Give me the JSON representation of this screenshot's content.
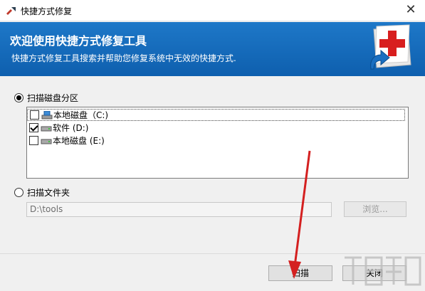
{
  "window": {
    "title": "快捷方式修复",
    "close_icon": "close-icon",
    "app_icon": "app-shortcut-icon"
  },
  "banner": {
    "title": "欢迎使用快捷方式修复工具",
    "description": "快捷方式修复工具搜索并帮助您修复系统中无效的快捷方式.",
    "logo_icon": "red-cross-repair-icon",
    "colors": {
      "top": "#1e78c8",
      "bottom": "#0e5fae",
      "cross": "#d81e1e"
    }
  },
  "scan_disk": {
    "label": "扫描磁盘分区",
    "selected": true,
    "drives": [
      {
        "label": "本地磁盘（C:)",
        "checked": false,
        "icon": "system-drive-icon",
        "focused": true
      },
      {
        "label": "软件 (D:)",
        "checked": true,
        "icon": "hard-drive-icon",
        "focused": false
      },
      {
        "label": "本地磁盘 (E:)",
        "checked": false,
        "icon": "hard-drive-icon",
        "focused": false
      }
    ]
  },
  "scan_folder": {
    "label": "扫描文件夹",
    "selected": false,
    "path_value": "D:\\tools",
    "browse_label": "浏览..."
  },
  "footer": {
    "scan_label": "扫描",
    "close_label": "关闭"
  },
  "annotation": {
    "arrow_color": "#d42020"
  }
}
